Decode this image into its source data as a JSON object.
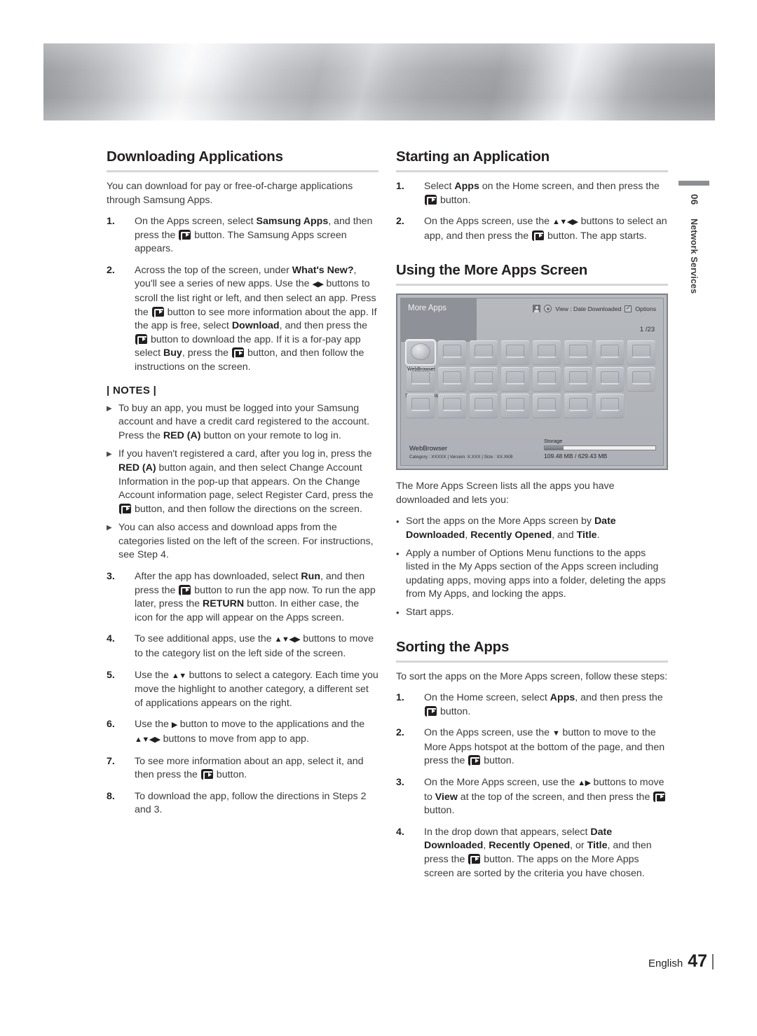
{
  "header": {
    "banner_alt": "brushed-metal-banner"
  },
  "side_tab": {
    "number": "06",
    "name": "Network Services"
  },
  "left_column": {
    "section_title": "Downloading Applications",
    "intro": "You can download for pay or free-of-charge applications through Samsung Apps.",
    "steps": [
      {
        "num": "1.",
        "segments": [
          {
            "t": "On the Apps screen, select "
          },
          {
            "t": "Samsung Apps",
            "b": true
          },
          {
            "t": ", and then press the "
          },
          {
            "icon": "enter-button"
          },
          {
            "t": " button. The Samsung Apps screen appears."
          }
        ]
      },
      {
        "num": "2.",
        "segments": [
          {
            "t": "Across the top of the screen, under "
          },
          {
            "t": "What's New?",
            "b": true
          },
          {
            "t": ", you'll see a series of new apps. Use the "
          },
          {
            "arrows": "◀▶"
          },
          {
            "t": " buttons to scroll the list right or left, and then select an app. Press the "
          },
          {
            "icon": "enter-button"
          },
          {
            "t": " button to see more information about the app. If the app is free, select "
          },
          {
            "t": "Download",
            "b": true
          },
          {
            "t": ", and then press the "
          },
          {
            "icon": "enter-button"
          },
          {
            "t": " button to download the app. If it is a for-pay app select "
          },
          {
            "t": "Buy",
            "b": true
          },
          {
            "t": ", press the "
          },
          {
            "icon": "enter-button"
          },
          {
            "t": " button, and then follow the instructions on the screen."
          }
        ]
      }
    ],
    "notes_heading": "| NOTES |",
    "notes": [
      {
        "segments": [
          {
            "t": "To buy an app, you must be logged into your Samsung account and have a credit card registered to the account. Press the "
          },
          {
            "t": "RED (A)",
            "b": true
          },
          {
            "t": " button on your remote to log in."
          }
        ]
      },
      {
        "segments": [
          {
            "t": "If you haven't registered a card, after you log in, press the "
          },
          {
            "t": "RED (A)",
            "b": true
          },
          {
            "t": " button again, and then select Change Account Information in the pop-up that appears. On the Change Account information page, select Register Card, press the "
          },
          {
            "icon": "enter-button"
          },
          {
            "t": " button, and then follow the directions on the screen."
          }
        ]
      },
      {
        "segments": [
          {
            "t": "You can also access and download apps from the categories listed on the left of the screen. For instructions, see Step 4."
          }
        ]
      }
    ],
    "steps_cont": [
      {
        "num": "3.",
        "segments": [
          {
            "t": "After the app has downloaded, select "
          },
          {
            "t": "Run",
            "b": true
          },
          {
            "t": ", and then press the "
          },
          {
            "icon": "enter-button"
          },
          {
            "t": " button to run the app now. To run the app later, press the "
          },
          {
            "t": "RETURN",
            "b": true
          },
          {
            "t": " button. In either case, the icon for the app will appear on the Apps screen."
          }
        ]
      },
      {
        "num": "4.",
        "segments": [
          {
            "t": "To see additional apps, use the "
          },
          {
            "arrows": "▲▼◀▶"
          },
          {
            "t": " buttons to move to the category list on the left side of the screen."
          }
        ]
      },
      {
        "num": "5.",
        "segments": [
          {
            "t": "Use the "
          },
          {
            "arrows": "▲▼"
          },
          {
            "t": " buttons to select a category. Each time you move the highlight to another category, a different set of applications appears on the right."
          }
        ]
      },
      {
        "num": "6.",
        "segments": [
          {
            "t": "Use the "
          },
          {
            "arrows": "▶"
          },
          {
            "t": " button to move to the applications and the "
          },
          {
            "arrows": "▲▼◀▶"
          },
          {
            "t": " buttons to move from app to app."
          }
        ]
      },
      {
        "num": "7.",
        "segments": [
          {
            "t": "To see more information about an app, select it, and then press the "
          },
          {
            "icon": "enter-button"
          },
          {
            "t": " button."
          }
        ]
      },
      {
        "num": "8.",
        "segments": [
          {
            "t": "To download the app, follow the directions in Steps 2 and 3."
          }
        ]
      }
    ]
  },
  "right_column": {
    "section1_title": "Starting an Application",
    "section1_steps": [
      {
        "num": "1.",
        "segments": [
          {
            "t": "Select "
          },
          {
            "t": "Apps",
            "b": true
          },
          {
            "t": " on the Home screen, and then press the "
          },
          {
            "icon": "enter-button"
          },
          {
            "t": " button."
          }
        ]
      },
      {
        "num": "2.",
        "segments": [
          {
            "t": "On the Apps screen, use the "
          },
          {
            "arrows": "▲▼◀▶"
          },
          {
            "t": " buttons to select an app, and then press the "
          },
          {
            "icon": "enter-button"
          },
          {
            "t": " button. The app starts."
          }
        ]
      }
    ],
    "section2_title": "Using the More Apps Screen",
    "tv_screen": {
      "title": "More Apps",
      "toolbar": {
        "view_label": "View : Date Downloaded",
        "options_label": "Options"
      },
      "page_indicator": "1 /23",
      "selected_app": "WebBrowser",
      "second_app": "Samsung Apps",
      "rows": [
        8,
        8,
        7
      ],
      "footer_app_name": "WebBrowser",
      "footer_app_meta": "Category : XXXXX  |  Version: X.XXX  |  Size : XX.XKB",
      "storage_label": "Storage",
      "storage_value": "109.48 MB / 629.43 MB"
    },
    "after_image_intro": "The More Apps Screen lists all the apps you have downloaded and lets you:",
    "bullets": [
      {
        "segments": [
          {
            "t": "Sort the apps on the More Apps screen by "
          },
          {
            "t": "Date Downloaded",
            "b": true
          },
          {
            "t": ", "
          },
          {
            "t": "Recently Opened",
            "b": true
          },
          {
            "t": ", and "
          },
          {
            "t": "Title",
            "b": true
          },
          {
            "t": "."
          }
        ]
      },
      {
        "segments": [
          {
            "t": "Apply a number of Options Menu functions to the apps listed in the My Apps section of the Apps screen including updating apps, moving apps into a folder, deleting the apps from My Apps, and locking the apps."
          }
        ]
      },
      {
        "segments": [
          {
            "t": "Start apps."
          }
        ]
      }
    ],
    "section3_title": "Sorting the Apps",
    "section3_intro": "To sort the apps on the More Apps screen, follow these steps:",
    "section3_steps": [
      {
        "num": "1.",
        "segments": [
          {
            "t": "On the Home screen, select "
          },
          {
            "t": "Apps",
            "b": true
          },
          {
            "t": ", and then press the "
          },
          {
            "icon": "enter-button"
          },
          {
            "t": " button."
          }
        ]
      },
      {
        "num": "2.",
        "segments": [
          {
            "t": "On the Apps screen, use the "
          },
          {
            "arrows": "▼"
          },
          {
            "t": " button to move to the More Apps hotspot at the bottom of the page, and then press the "
          },
          {
            "icon": "enter-button"
          },
          {
            "t": " button."
          }
        ]
      },
      {
        "num": "3.",
        "segments": [
          {
            "t": "On the More Apps screen, use the "
          },
          {
            "arrows": "▲▶"
          },
          {
            "t": " buttons to move to "
          },
          {
            "t": "View",
            "b": true
          },
          {
            "t": " at the top of the screen, and then press the "
          },
          {
            "icon": "enter-button"
          },
          {
            "t": " button."
          }
        ]
      },
      {
        "num": "4.",
        "segments": [
          {
            "t": "In the drop down that appears, select "
          },
          {
            "t": "Date Downloaded",
            "b": true
          },
          {
            "t": ", "
          },
          {
            "t": "Recently Opened",
            "b": true
          },
          {
            "t": ", or "
          },
          {
            "t": "Title",
            "b": true
          },
          {
            "t": ", and then press the "
          },
          {
            "icon": "enter-button"
          },
          {
            "t": " button. The apps on the More Apps screen are sorted by the criteria you have chosen."
          }
        ]
      }
    ]
  },
  "footer": {
    "language": "English",
    "page_number": "47"
  }
}
